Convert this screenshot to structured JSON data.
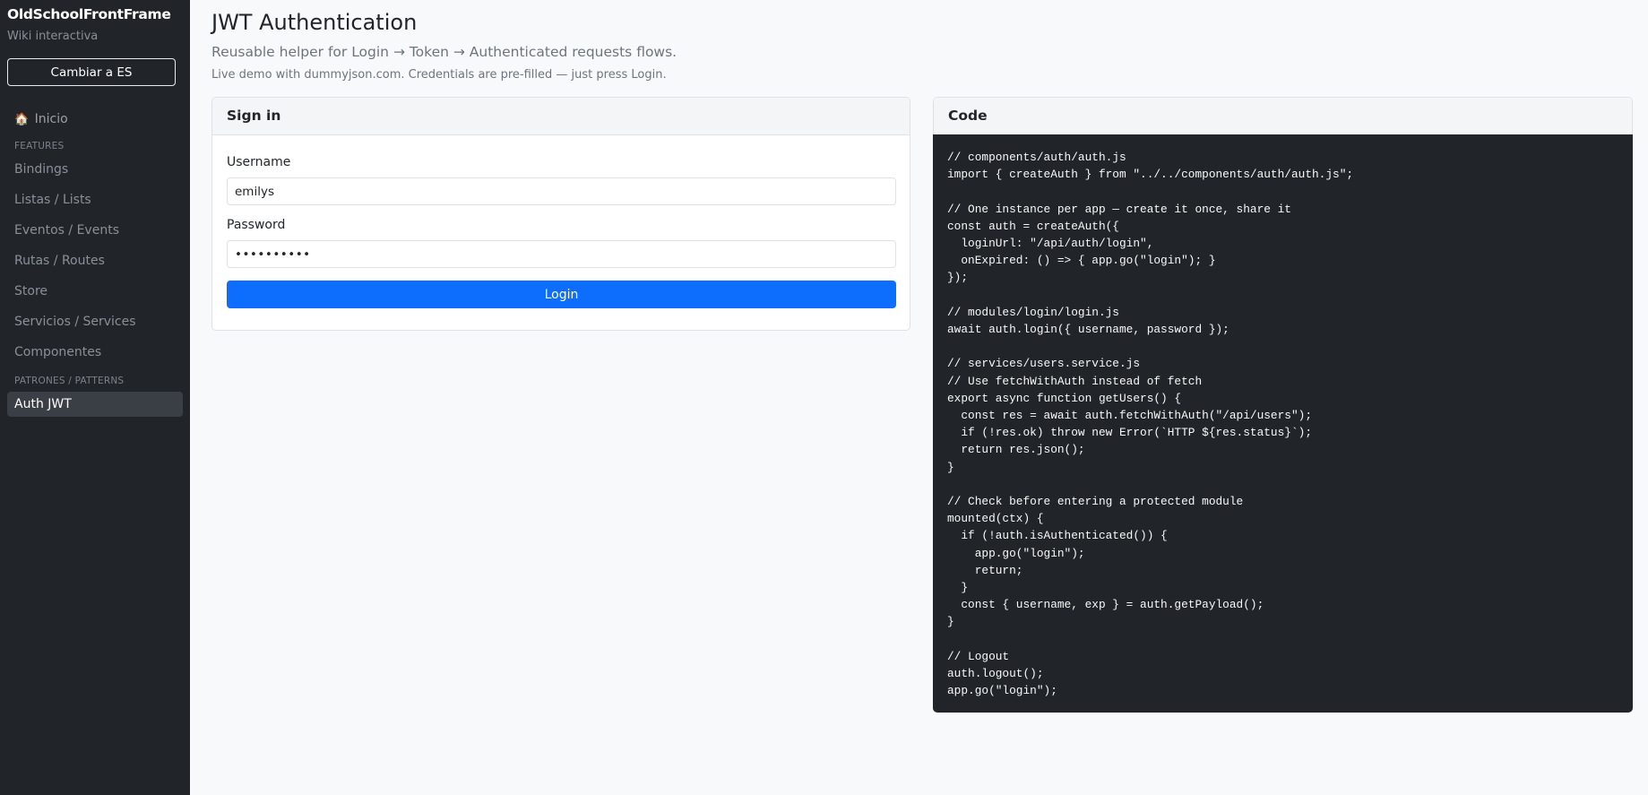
{
  "sidebar": {
    "brand": "OldSchoolFrontFrame",
    "subtitle": "Wiki interactiva",
    "lang_button": "Cambiar a ES",
    "home": {
      "icon": "home-icon",
      "label": "Inicio"
    },
    "features_heading": "FEATURES",
    "features": [
      {
        "label": "Bindings"
      },
      {
        "label": "Listas / Lists"
      },
      {
        "label": "Eventos / Events"
      },
      {
        "label": "Rutas / Routes"
      },
      {
        "label": "Store"
      },
      {
        "label": "Servicios / Services"
      },
      {
        "label": "Componentes"
      }
    ],
    "patterns_heading": "PATRONES / PATTERNS",
    "patterns": [
      {
        "label": "Auth JWT",
        "active": true
      }
    ]
  },
  "main": {
    "title": "JWT Authentication",
    "lead": "Reusable helper for Login → Token → Authenticated requests flows.",
    "note": "Live demo with dummyjson.com. Credentials are pre-filled — just press Login."
  },
  "login_card": {
    "header": "Sign in",
    "username_label": "Username",
    "username_value": "emilys",
    "password_label": "Password",
    "password_value": "emilyspass",
    "login_button": "Login"
  },
  "code_card": {
    "header": "Code",
    "code": "// components/auth/auth.js\nimport { createAuth } from \"../../components/auth/auth.js\";\n\n// One instance per app — create it once, share it\nconst auth = createAuth({\n  loginUrl: \"/api/auth/login\",\n  onExpired: () => { app.go(\"login\"); }\n});\n\n// modules/login/login.js\nawait auth.login({ username, password });\n\n// services/users.service.js\n// Use fetchWithAuth instead of fetch\nexport async function getUsers() {\n  const res = await auth.fetchWithAuth(\"/api/users\");\n  if (!res.ok) throw new Error(`HTTP ${res.status}`);\n  return res.json();\n}\n\n// Check before entering a protected module\nmounted(ctx) {\n  if (!auth.isAuthenticated()) {\n    app.go(\"login\");\n    return;\n  }\n  const { username, exp } = auth.getPayload();\n}\n\n// Logout\nauth.logout();\napp.go(\"login\");"
  },
  "colors": {
    "sidebar_bg": "#212529",
    "primary": "#0d6efd",
    "code_bg": "#212529",
    "page_bg": "#f8f9fa"
  }
}
